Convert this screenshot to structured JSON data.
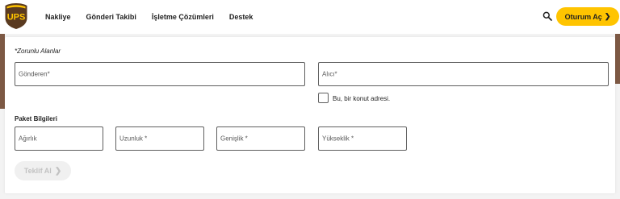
{
  "brand": {
    "logo_text": "UPS",
    "accent": "#ffc400",
    "brown": "#7d5944"
  },
  "nav": {
    "items": [
      {
        "label": "Nakliye"
      },
      {
        "label": "Gönderi Takibi"
      },
      {
        "label": "İşletme Çözümleri"
      },
      {
        "label": "Destek"
      }
    ]
  },
  "header": {
    "login_label": "Oturum Aç",
    "search_icon": "search-icon"
  },
  "form": {
    "required_note": "*Zorunlu Alanlar",
    "sender_placeholder": "Gönderen*",
    "recipient_placeholder": "Alıcı*",
    "residential_label": "Bu, bir konut adresi.",
    "residential_checked": false,
    "package_title": "Paket Bilgileri",
    "weight_placeholder": "Ağırlık",
    "length_placeholder": "Uzunluk *",
    "width_placeholder": "Genişlik *",
    "height_placeholder": "Yükseklik *",
    "quote_button": "Teklif Al"
  }
}
